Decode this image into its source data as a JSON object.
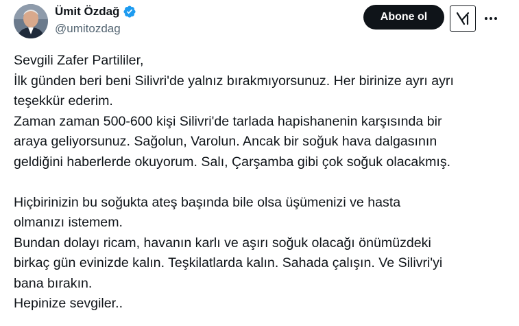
{
  "user": {
    "display_name": "Ümit Özdağ",
    "handle": "@umitozdag",
    "verified": true
  },
  "actions": {
    "follow_label": "Abone ol",
    "grok_icon": "grok-icon",
    "more_icon": "more-horizontal-icon"
  },
  "tweet": {
    "lines": [
      "Sevgili Zafer Partililer,",
      "İlk günden beri beni Silivri'de yalnız bırakmıyorsunuz. Her birinize ayrı ayrı",
      "teşekkür ederim.",
      "Zaman zaman 500-600 kişi Silivri'de tarlada hapishanenin karşısında bir",
      "araya geliyorsunuz. Sağolun, Varolun. Ancak bir soğuk hava dalgasının",
      "geldiğini haberlerde okuyorum. Salı, Çarşamba gibi çok soğuk olacakmış.",
      "",
      "Hiçbirinizin bu soğukta ateş başında bile olsa üşümenizi ve hasta",
      "olmanızı istemem.",
      "Bundan dolayı ricam, havanın karlı ve aşırı soğuk olacağı önümüzdeki",
      "birkaç gün evinizde kalın. Teşkilatlarda kalın. Sahada çalışın. Ve Silivri'yi",
      "bana bırakın.",
      "Hepinize sevgiler.."
    ]
  },
  "colors": {
    "text": "#0f1419",
    "secondary_text": "#536471",
    "verified_blue": "#1d9bf0",
    "follow_bg": "#0f1419"
  }
}
